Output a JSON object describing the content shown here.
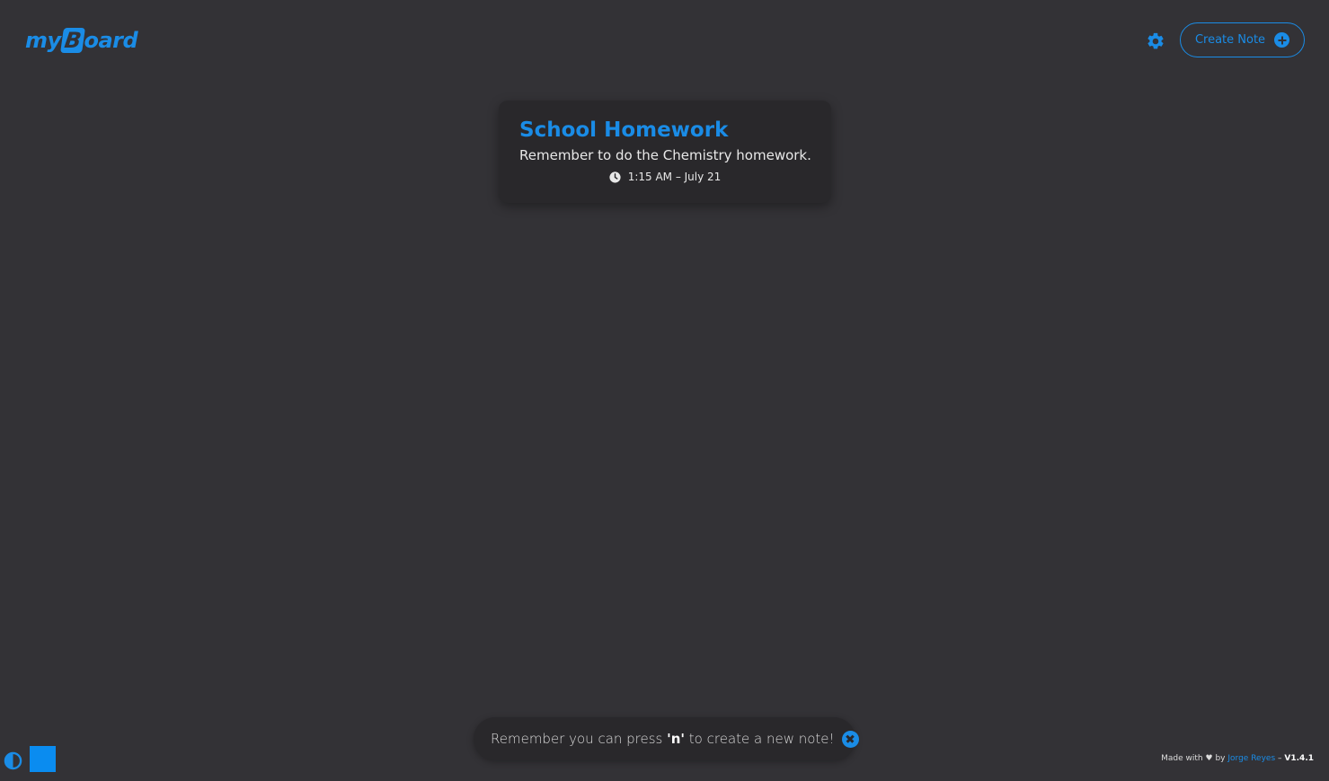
{
  "header": {
    "logo_prefix": "my",
    "logo_box_letter": "B",
    "logo_suffix": "oard",
    "create_note_label": "Create Note"
  },
  "notes": [
    {
      "title": "School Homework",
      "body": "Remember to do the Chemistry homework.",
      "time": "1:15 AM – July 21"
    }
  ],
  "toast": {
    "text_before": "Remember you can press ",
    "key": "'n'",
    "text_after": " to create a new note!"
  },
  "footer": {
    "made_with": "Made with",
    "heart": "♥",
    "by": "by",
    "author": "Jorge Reyes",
    "separator": "–",
    "version": "V1.4.1"
  },
  "colors": {
    "accent": "#1a8ce6",
    "background": "#333236",
    "card": "#29282b",
    "swatch": "#0a8cf0"
  },
  "icons": {
    "settings": "gear-icon",
    "create": "plus-circle-icon",
    "time": "clock-icon",
    "dismiss": "close-circle-icon",
    "theme": "half-circle-contrast-icon"
  }
}
